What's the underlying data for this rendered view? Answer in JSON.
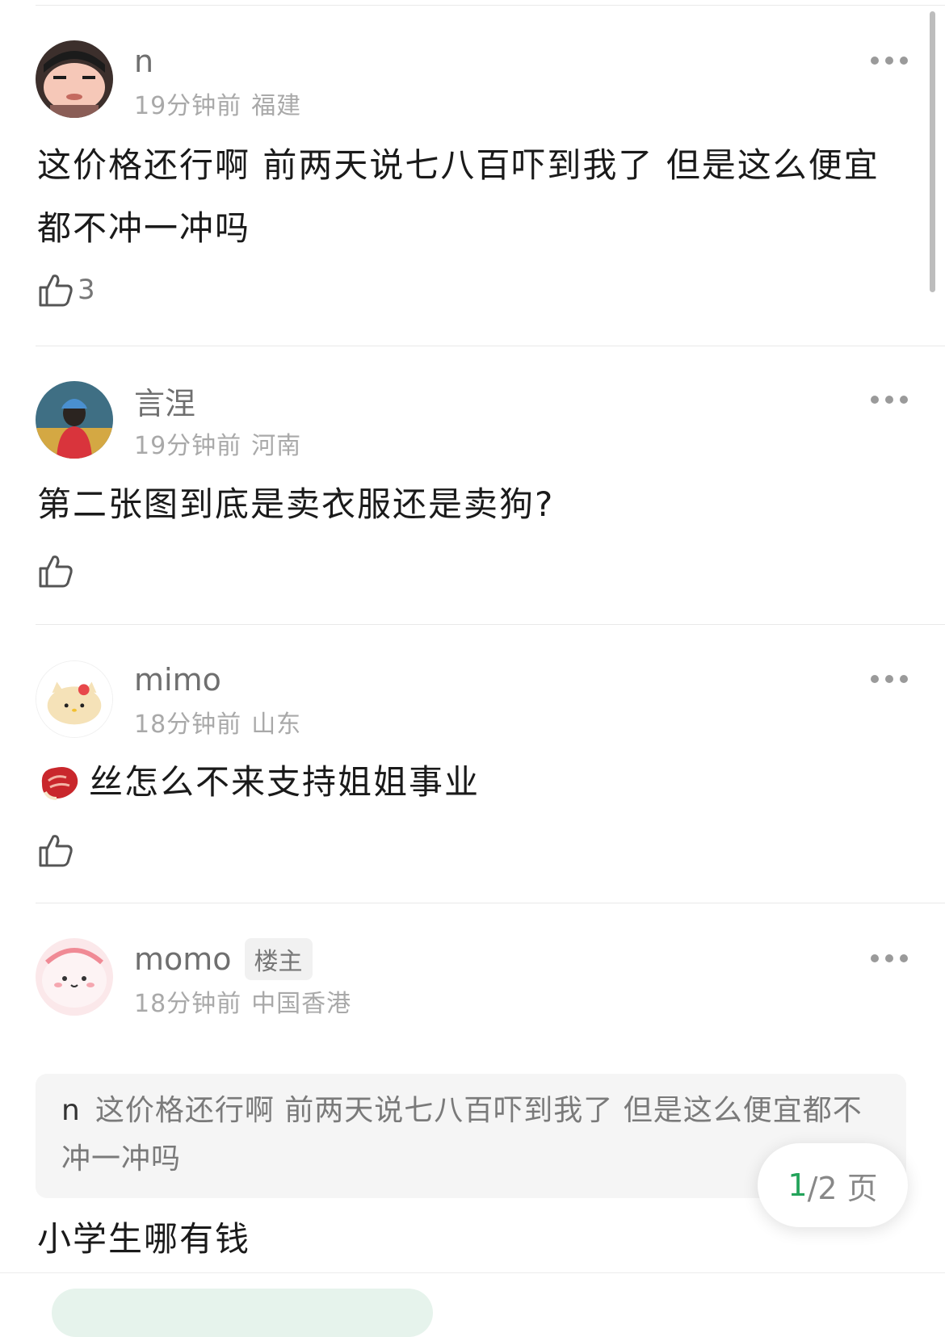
{
  "comments": [
    {
      "username": "n",
      "time": "19分钟前",
      "location": "福建",
      "text": "这价格还行啊 前两天说七八百吓到我了 但是这么便宜都不冲一冲吗",
      "likes": "3",
      "avatar_icon": "cartoon-boy-avatar-icon"
    },
    {
      "username": "言涅",
      "time": "19分钟前",
      "location": "河南",
      "text": "第二张图到底是卖衣服还是卖狗?",
      "likes": "",
      "avatar_icon": "person-blue-cap-avatar-icon"
    },
    {
      "username": "mimo",
      "time": "18分钟前",
      "location": "山东",
      "text": "丝怎么不来支持姐姐事业",
      "likes": "",
      "avatar_icon": "hello-kitty-bun-avatar-icon",
      "leading_emoji": "steak-emoji-icon"
    },
    {
      "username": "momo",
      "tag": "楼主",
      "time": "18分钟前",
      "location": "中国香港",
      "quote_user": "n",
      "quote_text": "这价格还行啊 前两天说七八百吓到我了 但是这么便宜都不冲一冲吗",
      "text": "小学生哪有钱",
      "avatar_icon": "pink-cartoon-avatar-icon"
    }
  ],
  "pager": {
    "current": "1",
    "total": "/2 页"
  },
  "colors": {
    "accent": "#23a35a",
    "meta": "#a9a9a9",
    "username": "#6f6f6f"
  }
}
